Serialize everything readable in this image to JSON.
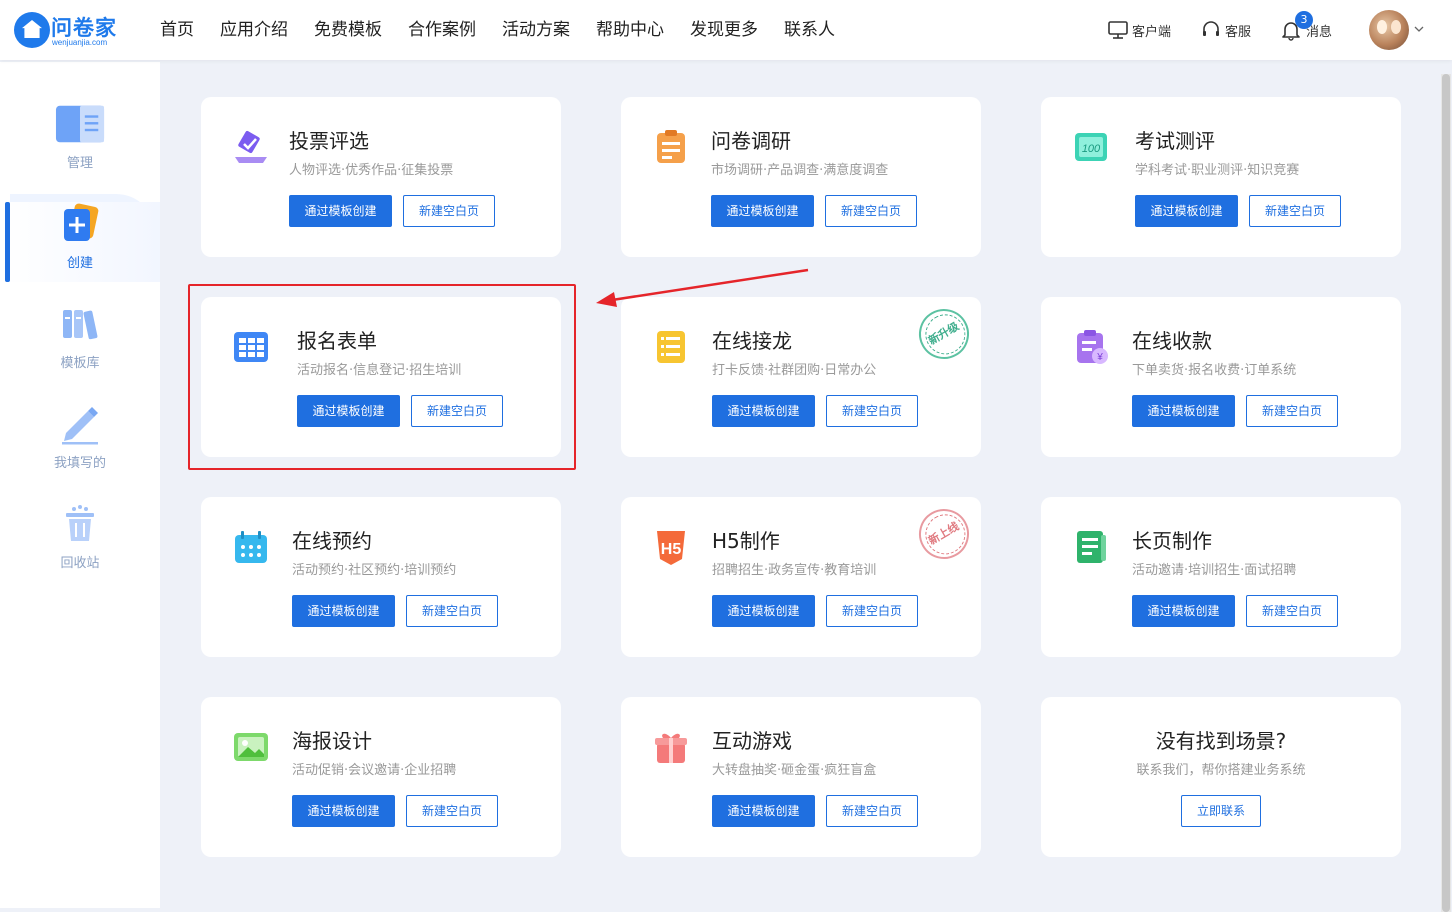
{
  "header": {
    "logo_text": "问卷家",
    "logo_sub": "wenjuanjia.com",
    "nav": [
      "首页",
      "应用介绍",
      "免费模板",
      "合作案例",
      "活动方案",
      "帮助中心",
      "发现更多",
      "联系人"
    ],
    "client_label": "客户端",
    "service_label": "客服",
    "message_label": "消息",
    "message_count": "3"
  },
  "sidebar": {
    "items": [
      {
        "label": "管理",
        "icon": "manage-icon"
      },
      {
        "label": "创建",
        "icon": "create-icon",
        "active": true
      },
      {
        "label": "模板库",
        "icon": "template-library-icon"
      },
      {
        "label": "我填写的",
        "icon": "pen-icon"
      },
      {
        "label": "回收站",
        "icon": "trash-icon"
      }
    ]
  },
  "cards": [
    {
      "title": "投票评选",
      "desc": "人物评选·优秀作品·征集投票",
      "btn1": "通过模板创建",
      "btn2": "新建空白页",
      "icon": "vote-icon"
    },
    {
      "title": "问卷调研",
      "desc": "市场调研·产品调查·满意度调查",
      "btn1": "通过模板创建",
      "btn2": "新建空白页",
      "icon": "survey-icon"
    },
    {
      "title": "考试测评",
      "desc": "学科考试·职业测评·知识竞赛",
      "btn1": "通过模板创建",
      "btn2": "新建空白页",
      "icon": "exam-icon"
    },
    {
      "title": "报名表单",
      "desc": "活动报名·信息登记·招生培训",
      "btn1": "通过模板创建",
      "btn2": "新建空白页",
      "icon": "form-icon"
    },
    {
      "title": "在线接龙",
      "desc": "打卡反馈·社群团购·日常办公",
      "btn1": "通过模板创建",
      "btn2": "新建空白页",
      "icon": "relay-icon",
      "stamp": "新升级"
    },
    {
      "title": "在线收款",
      "desc": "下单卖货·报名收费·订单系统",
      "btn1": "通过模板创建",
      "btn2": "新建空白页",
      "icon": "payment-icon"
    },
    {
      "title": "在线预约",
      "desc": "活动预约·社区预约·培训预约",
      "btn1": "通过模板创建",
      "btn2": "新建空白页",
      "icon": "calendar-icon"
    },
    {
      "title": "H5制作",
      "desc": "招聘招生·政务宣传·教育培训",
      "btn1": "通过模板创建",
      "btn2": "新建空白页",
      "icon": "h5-icon",
      "stamp": "新上线"
    },
    {
      "title": "长页制作",
      "desc": "活动邀请·培训招生·面试招聘",
      "btn1": "通过模板创建",
      "btn2": "新建空白页",
      "icon": "long-page-icon"
    },
    {
      "title": "海报设计",
      "desc": "活动促销·会议邀请·企业招聘",
      "btn1": "通过模板创建",
      "btn2": "新建空白页",
      "icon": "poster-icon"
    },
    {
      "title": "互动游戏",
      "desc": "大转盘抽奖·砸金蛋·疯狂盲盒",
      "btn1": "通过模板创建",
      "btn2": "新建空白页",
      "icon": "gift-icon"
    }
  ],
  "contact_card": {
    "title": "没有找到场景?",
    "desc": "联系我们，帮你搭建业务系统",
    "button": "立即联系"
  },
  "colors": {
    "primary": "#1f6fe0",
    "highlight": "#e5252a",
    "background": "#eef1f8"
  }
}
